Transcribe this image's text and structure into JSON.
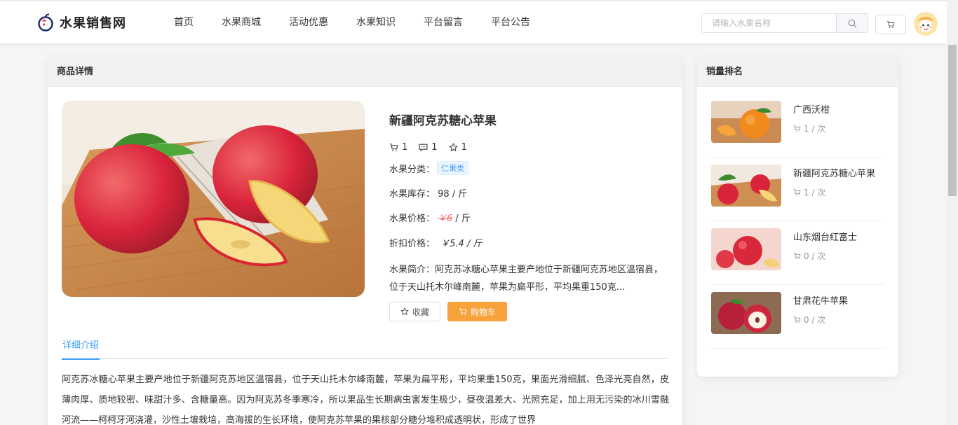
{
  "brand": {
    "name": "水果销售网"
  },
  "nav": [
    "首页",
    "水果商城",
    "活动优惠",
    "水果知识",
    "平台留言",
    "平台公告"
  ],
  "search": {
    "placeholder": "请输入水果名称"
  },
  "detail": {
    "panel_title": "商品详情",
    "product_name": "新疆阿克苏糖心苹果",
    "cart_count": "1",
    "comment_count": "1",
    "fav_count": "1",
    "category_label": "水果分类：",
    "category": "仁果类",
    "stock_label": "水果库存：",
    "stock_value": "98 / 斤",
    "price_label": "水果价格：",
    "price_value": "￥6",
    "price_unit": " / 斤",
    "discount_label": "折扣价格：",
    "discount_value": "￥5.4 / 斤",
    "intro_label": "水果简介：",
    "intro_text": "阿克苏冰糖心苹果主要产地位于新疆阿克苏地区温宿县，位于天山托木尔峰南麓，苹果为扁平形，平均果重150克...",
    "fav_button": "收藏",
    "cart_button": "购物车",
    "tab_label": "详细介绍",
    "description": "阿克苏冰糖心苹果主要产地位于新疆阿克苏地区温宿县，位于天山托木尔峰南麓，苹果为扁平形，平均果重150克，果面光滑细腻、色泽光亮自然，皮薄肉厚、质地较密、味甜汁多、含糖量高。因为阿克苏冬季寒冷，所以果品生长期病虫害发生极少，昼夜温差大、光照充足，加上用无污染的冰川雪融河流——柯柯牙河浇灌，沙性土壤栽培，高海拔的生长环境，使阿克苏苹果的果核部分糖分堆积成透明状，形成了世界"
  },
  "ranking": {
    "panel_title": "销量排名",
    "items": [
      {
        "name": "广西沃柑",
        "count": "1 / 次"
      },
      {
        "name": "新疆阿克苏糖心苹果",
        "count": "1 / 次"
      },
      {
        "name": "山东烟台红富士",
        "count": "0 / 次"
      },
      {
        "name": "甘肃花牛苹果",
        "count": "0 / 次"
      }
    ]
  },
  "colors": {
    "accent": "#409eff",
    "cart_button": "#f7a23b",
    "strike_price": "#f56c6c"
  }
}
